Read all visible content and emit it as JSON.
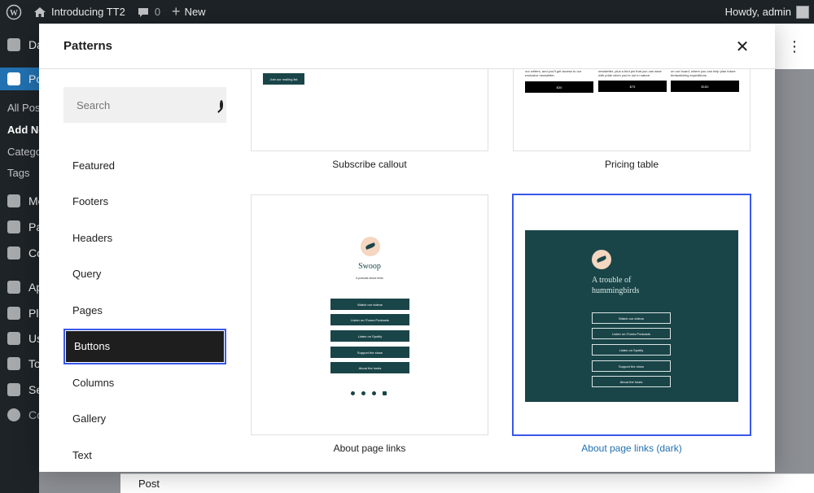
{
  "adminbar": {
    "site_name": "Introducing TT2",
    "comments_count": "0",
    "new_label": "New",
    "howdy": "Howdy, admin"
  },
  "adminmenu": {
    "items": [
      {
        "label": "Dashboard"
      },
      {
        "label": "Posts"
      },
      {
        "label": "Media"
      },
      {
        "label": "Pages"
      },
      {
        "label": "Comments"
      },
      {
        "label": "Appearance"
      },
      {
        "label": "Plugins"
      },
      {
        "label": "Users"
      },
      {
        "label": "Tools"
      },
      {
        "label": "Settings"
      },
      {
        "label": "Collapse menu"
      }
    ],
    "subitems": [
      {
        "label": "All Posts"
      },
      {
        "label": "Add New"
      },
      {
        "label": "Categories"
      },
      {
        "label": "Tags"
      }
    ]
  },
  "editor": {
    "more_glyph": "⋮",
    "bottom_label": "Post"
  },
  "modal": {
    "title": "Patterns",
    "close_glyph": "✕",
    "search_placeholder": "Search",
    "categories": [
      {
        "label": "Featured"
      },
      {
        "label": "Footers"
      },
      {
        "label": "Headers"
      },
      {
        "label": "Query"
      },
      {
        "label": "Pages"
      },
      {
        "label": "Buttons",
        "active": true
      },
      {
        "label": "Columns"
      },
      {
        "label": "Gallery"
      },
      {
        "label": "Text"
      }
    ],
    "patterns": [
      {
        "label": "Subscribe callout",
        "preview": {
          "button": "Join our mailing list"
        }
      },
      {
        "label": "Pricing table",
        "preview": {
          "descriptions": [
            "our writers, and you'll get access to our exclusive newsletter.",
            "newsletter, plus a bird pin that you can wear with pride when you're out in nature.",
            "on our board, where you can help plan future birdwatching expeditions."
          ],
          "prices": [
            "$30",
            "$75",
            "$150"
          ]
        }
      },
      {
        "label": "About page links",
        "preview": {
          "title": "Swoop",
          "subtitle": "A podcast about birds",
          "buttons": [
            "Watch our videos",
            "Listen on iTunes Podcasts",
            "Listen on Spotify",
            "Support the show",
            "About the hosts"
          ]
        }
      },
      {
        "label": "About page links (dark)",
        "selected": true,
        "preview": {
          "title": "A trouble of hummingbirds",
          "buttons": [
            "Watch our videos",
            "Listen on iTunes Podcasts",
            "Listen on Spotify",
            "Support the show",
            "About the hosts"
          ]
        }
      }
    ]
  }
}
